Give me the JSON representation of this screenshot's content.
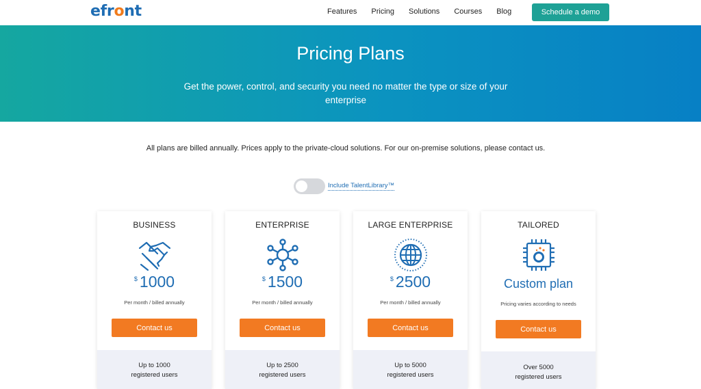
{
  "header": {
    "logo_pre": "efr",
    "logo_o": "o",
    "logo_post": "nt",
    "nav": [
      "Features",
      "Pricing",
      "Solutions",
      "Courses",
      "Blog"
    ],
    "cta": "Schedule a demo"
  },
  "hero": {
    "title": "Pricing Plans",
    "subtitle": "Get the power, control, and security you need no matter the type or size of your enterprise"
  },
  "note": "All plans are billed annually. Prices apply to the private-cloud solutions. For our on-premise solutions, please contact us.",
  "toggle": {
    "label": "Include TalentLibrary™",
    "on": false
  },
  "plans": [
    {
      "name": "BUSINESS",
      "icon": "handshake-icon",
      "currency": "$",
      "price": "1000",
      "period": "Per month / billed annually",
      "cta": "Contact us",
      "users_line1": "Up to 1000",
      "users_line2": "registered users"
    },
    {
      "name": "ENTERPRISE",
      "icon": "network-hub-icon",
      "currency": "$",
      "price": "1500",
      "period": "Per month / billed annually",
      "cta": "Contact us",
      "users_line1": "Up to 2500",
      "users_line2": "registered users"
    },
    {
      "name": "LARGE ENTERPRISE",
      "icon": "globe-icon",
      "currency": "$",
      "price": "2500",
      "period": "Per month / billed annually",
      "cta": "Contact us",
      "users_line1": "Up to 5000",
      "users_line2": "registered users"
    },
    {
      "name": "TAILORED",
      "icon": "chip-icon",
      "custom": "Custom plan",
      "period": "Pricing varies according to needs",
      "cta": "Contact us",
      "users_line1": "Over 5000",
      "users_line2": "registered users"
    }
  ],
  "colors": {
    "brand_blue": "#1f6db3",
    "accent_orange": "#f27a22",
    "teal": "#1ea196"
  }
}
